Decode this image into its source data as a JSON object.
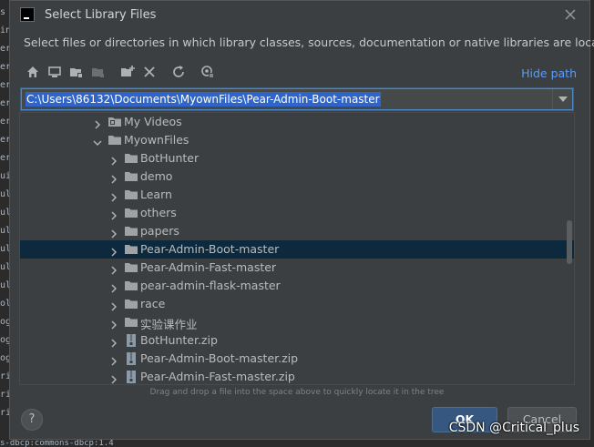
{
  "window": {
    "title": "Select Library Files",
    "description": "Select files or directories in which library classes, sources, documentation or native libraries are located"
  },
  "toolbar": {
    "icons": [
      "home-icon",
      "desktop-icon",
      "project-folder-icon",
      "module-folder-icon",
      "new-folder-icon",
      "delete-icon",
      "refresh-icon",
      "show-hidden-icon"
    ],
    "hide_path_label": "Hide path"
  },
  "path": {
    "value": "C:\\Users\\86132\\Documents\\MyownFiles\\Pear-Admin-Boot-master"
  },
  "tree": {
    "rows": [
      {
        "label": "My Videos",
        "type": "special-folder",
        "level": 1,
        "expanded": false
      },
      {
        "label": "MyownFiles",
        "type": "folder",
        "level": 1,
        "expanded": true
      },
      {
        "label": "BotHunter",
        "type": "folder",
        "level": 2,
        "expanded": false
      },
      {
        "label": "demo",
        "type": "folder",
        "level": 2,
        "expanded": false
      },
      {
        "label": "Learn",
        "type": "folder",
        "level": 2,
        "expanded": false
      },
      {
        "label": "others",
        "type": "folder",
        "level": 2,
        "expanded": false
      },
      {
        "label": "papers",
        "type": "folder",
        "level": 2,
        "expanded": false
      },
      {
        "label": "Pear-Admin-Boot-master",
        "type": "folder",
        "level": 2,
        "expanded": false,
        "selected": true
      },
      {
        "label": "Pear-Admin-Fast-master",
        "type": "folder",
        "level": 2,
        "expanded": false
      },
      {
        "label": "pear-admin-flask-master",
        "type": "folder",
        "level": 2,
        "expanded": false
      },
      {
        "label": "race",
        "type": "folder",
        "level": 2,
        "expanded": false
      },
      {
        "label": "实验课作业",
        "type": "folder",
        "level": 2,
        "expanded": false
      },
      {
        "label": "BotHunter.zip",
        "type": "zip",
        "level": 2,
        "expanded": false
      },
      {
        "label": "Pear-Admin-Boot-master.zip",
        "type": "zip",
        "level": 2,
        "expanded": false
      },
      {
        "label": "Pear-Admin-Fast-master.zip",
        "type": "zip",
        "level": 2,
        "expanded": false
      }
    ]
  },
  "hint": "Drag and drop a file into the space above to quickly locate it in the tree",
  "buttons": {
    "help_label": "?",
    "ok_label": "OK",
    "cancel_label": "Cancel"
  },
  "background": {
    "left_fragments": [
      "s",
      "in",
      "er",
      "er",
      "er",
      "er",
      "er",
      "er",
      "er",
      "ui",
      "ul",
      "ul",
      "ul",
      "ul",
      "ul",
      "ul",
      "ol",
      "og",
      "og",
      "og",
      "ri",
      "ri",
      "ri"
    ],
    "bottom_text": "s-dbcp:commons-dbcp:1.4"
  },
  "watermark": "CSDN @Critical_plus",
  "colors": {
    "dialog_bg": "#3c3f41",
    "selection_bg": "#0d293e",
    "accent_link": "#589df6",
    "ok_button": "#365880",
    "path_highlight": "#2f65ca"
  }
}
